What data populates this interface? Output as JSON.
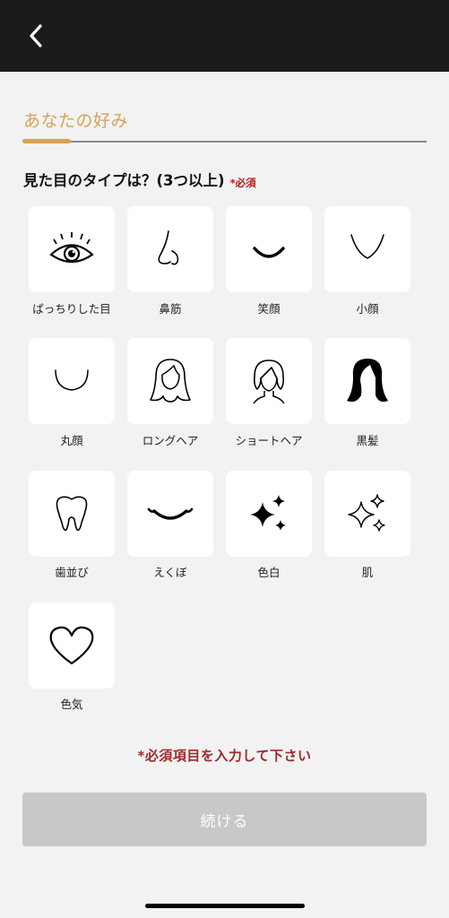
{
  "header": {
    "back_icon": "chevron-left-icon"
  },
  "section": {
    "title": "あなたの好み",
    "progress": 0.12
  },
  "question": {
    "text": "見た目のタイプは？(3つ以上)",
    "required_label": "*必須"
  },
  "options": [
    {
      "label": "ぱっちりした目",
      "icon": "eye-icon"
    },
    {
      "label": "鼻筋",
      "icon": "nose-icon"
    },
    {
      "label": "笑顔",
      "icon": "smile-icon"
    },
    {
      "label": "小顔",
      "icon": "small-face-icon"
    },
    {
      "label": "丸顔",
      "icon": "round-face-icon"
    },
    {
      "label": "ロングヘア",
      "icon": "long-hair-icon"
    },
    {
      "label": "ショートヘア",
      "icon": "short-hair-icon"
    },
    {
      "label": "黒髪",
      "icon": "black-hair-icon"
    },
    {
      "label": "歯並び",
      "icon": "tooth-icon"
    },
    {
      "label": "えくぼ",
      "icon": "dimple-smile-icon"
    },
    {
      "label": "色白",
      "icon": "sparkle-icon"
    },
    {
      "label": "肌",
      "icon": "sparkle-outline-icon"
    },
    {
      "label": "色気",
      "icon": "heart-icon"
    }
  ],
  "footer": {
    "error_message": "*必須項目を入力して下さい",
    "continue_label": "続ける"
  },
  "colors": {
    "accent": "#d3a35a",
    "error": "#9c2b2b",
    "button_disabled": "#c8c8c8",
    "topbar": "#1b1b1b"
  }
}
